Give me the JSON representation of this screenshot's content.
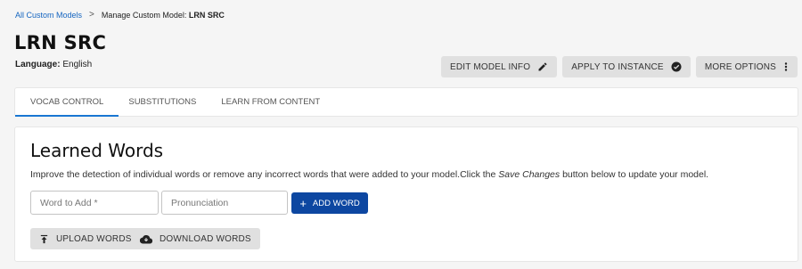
{
  "breadcrumb": {
    "root_label": "All Custom Models",
    "separator": ">",
    "current_prefix": "Manage Custom Model: ",
    "current_name": "LRN SRC"
  },
  "page": {
    "title": "LRN SRC",
    "language_label": "Language:",
    "language_value": " English"
  },
  "actions": {
    "edit": "EDIT MODEL INFO",
    "apply": "APPLY TO INSTANCE",
    "more": "MORE OPTIONS"
  },
  "tabs": [
    {
      "label": "VOCAB CONTROL",
      "active": true
    },
    {
      "label": "SUBSTITUTIONS",
      "active": false
    },
    {
      "label": "LEARN FROM CONTENT",
      "active": false
    }
  ],
  "learned_words": {
    "title": "Learned Words",
    "description_before": "Improve the detection of individual words or remove any incorrect words that were added to your model.Click the ",
    "description_emphasis": "Save Changes",
    "description_after": " button below to update your model.",
    "word_placeholder": "Word to Add *",
    "pronunciation_placeholder": "Pronunciation",
    "add_button": "ADD WORD",
    "upload_button": "UPLOAD WORDS",
    "download_button": "DOWNLOAD WORDS"
  },
  "colors": {
    "primary": "#0d47a1",
    "link": "#1565c0",
    "tab_indicator": "#1976d2",
    "background": "#f5f5f5"
  },
  "icons": {
    "edit": "pencil-icon",
    "apply": "check-circle-icon",
    "more": "vertical-dots-icon",
    "add": "plus-icon",
    "upload": "upload-icon",
    "download": "cloud-download-icon"
  }
}
